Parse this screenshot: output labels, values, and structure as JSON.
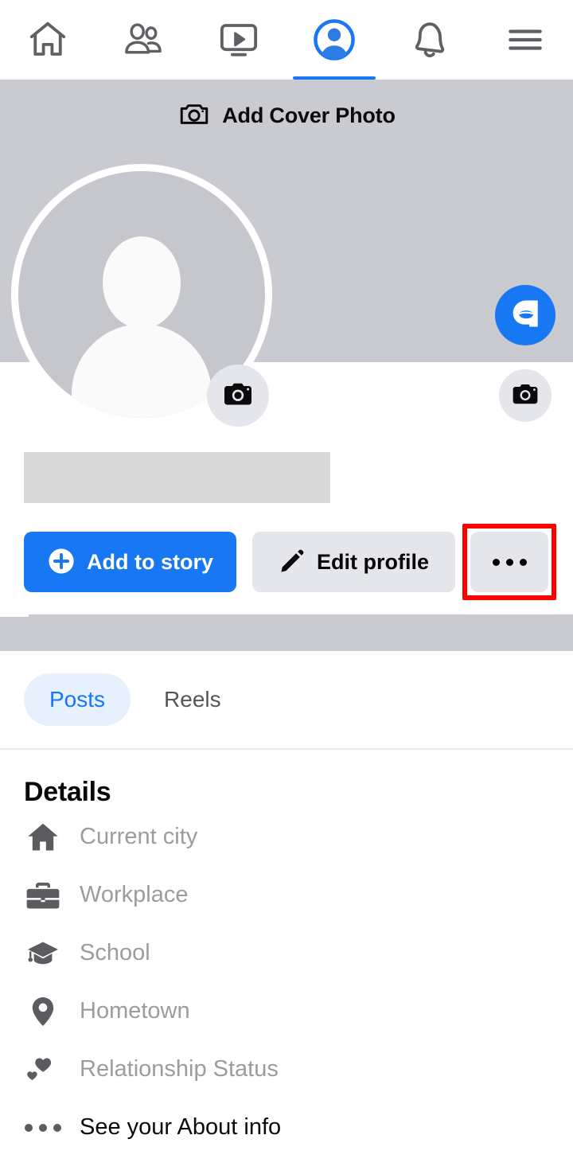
{
  "nav": {
    "items": [
      {
        "name": "home",
        "icon": "home-icon",
        "active": false
      },
      {
        "name": "friends",
        "icon": "friends-icon",
        "active": false
      },
      {
        "name": "video",
        "icon": "video-icon",
        "active": false
      },
      {
        "name": "profile",
        "icon": "profile-icon",
        "active": true
      },
      {
        "name": "notifications",
        "icon": "bell-icon",
        "active": false
      },
      {
        "name": "menu",
        "icon": "hamburger-menu-icon",
        "active": false
      }
    ]
  },
  "cover": {
    "add_cover_label": "Add Cover Photo",
    "camera_icon": "camera-outline-icon",
    "background_color": "#C9CBD1"
  },
  "floating": {
    "avatar_button_icon": "avatar-create-icon",
    "avatar_button_color": "#1877F2",
    "camera_button_icon": "camera-icon",
    "camera_button_color": "#E4E6EB"
  },
  "profile_photo": {
    "placeholder": "default-avatar",
    "edit_icon": "camera-icon"
  },
  "name_placeholder": {
    "is_skeleton": true,
    "color": "#D8D8D8"
  },
  "actions": {
    "add_to_story_label": "Add to story",
    "add_to_story_icon": "plus-circle-icon",
    "add_to_story_color": "#1877F2",
    "edit_profile_label": "Edit profile",
    "edit_profile_icon": "pencil-icon",
    "more_options_icon": "ellipsis-icon",
    "highlight_color": "#FF0000"
  },
  "tabs": {
    "items": [
      {
        "label": "Posts",
        "active": true
      },
      {
        "label": "Reels",
        "active": false
      }
    ],
    "active_color": "#1877F2",
    "active_bg": "#E7F0FD"
  },
  "details": {
    "title": "Details",
    "rows": [
      {
        "label": "Current city",
        "icon": "house-icon",
        "placeholder": true
      },
      {
        "label": "Workplace",
        "icon": "briefcase-icon",
        "placeholder": true
      },
      {
        "label": "School",
        "icon": "graduation-cap-icon",
        "placeholder": true
      },
      {
        "label": "Hometown",
        "icon": "location-pin-icon",
        "placeholder": true
      },
      {
        "label": "Relationship Status",
        "icon": "hearts-icon",
        "placeholder": true
      },
      {
        "label": "See your About info",
        "icon": "ellipsis-icon",
        "placeholder": false
      }
    ]
  }
}
